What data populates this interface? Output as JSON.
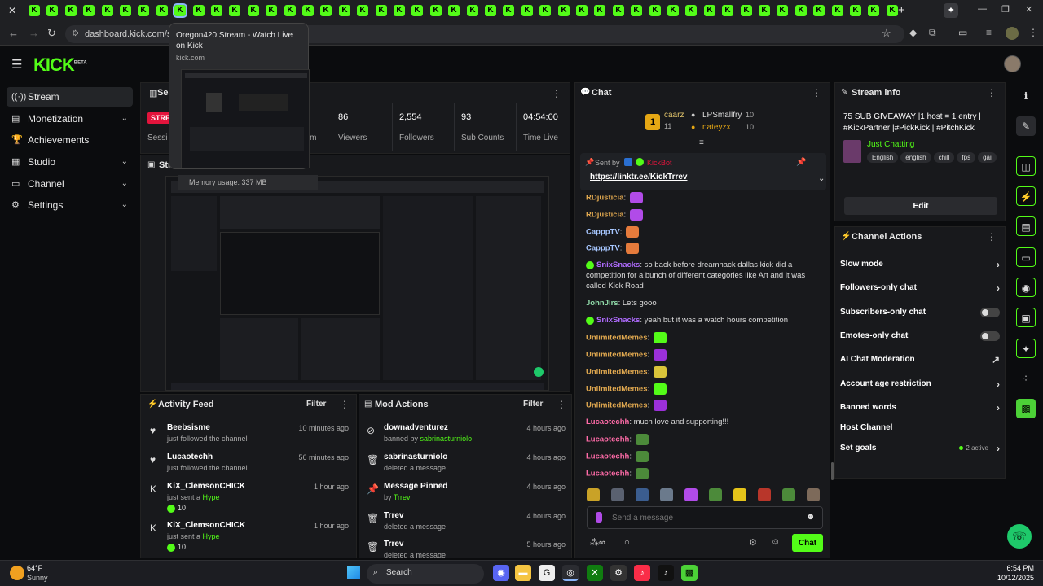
{
  "browser": {
    "tab_glyph": "K",
    "new_tab": "+",
    "url": "dashboard.kick.com/strea",
    "tooltip": {
      "title": "Oregon420 Stream - Watch Live on Kick",
      "host": "kick.com",
      "memory": "Memory usage: 337 MB"
    }
  },
  "header": {
    "logo": "KICK",
    "logo_badge": "BETA"
  },
  "sidebar": {
    "items": [
      {
        "label": "Stream",
        "icon": "((·))"
      },
      {
        "label": "Monetization",
        "icon": "▤"
      },
      {
        "label": "Achievements",
        "icon": "🏆"
      },
      {
        "label": "Studio",
        "icon": "▦"
      },
      {
        "label": "Channel",
        "icon": "▭"
      },
      {
        "label": "Settings",
        "icon": "⚙"
      }
    ]
  },
  "session": {
    "title": "Session",
    "live_badge": "STRE",
    "session_label": "Sessi",
    "stream_label": "eam",
    "stats": [
      {
        "value": "86",
        "label": "Viewers"
      },
      {
        "value": "2,554",
        "label": "Followers"
      },
      {
        "value": "93",
        "label": "Sub Counts"
      },
      {
        "value": "04:54:00",
        "label": "Time Live"
      }
    ]
  },
  "preview": {
    "title": "Str"
  },
  "activity_feed": {
    "title": "Activity Feed",
    "filter": "Filter",
    "items": [
      {
        "name": "Beebsisme",
        "sub": "just followed the channel",
        "time": "10 minutes ago",
        "icon": "♥"
      },
      {
        "name": "Lucaotechh",
        "sub": "just followed the channel",
        "time": "56 minutes ago",
        "icon": "♥"
      },
      {
        "name": "KiX_ClemsonCHICK",
        "sub_pre": "just sent a ",
        "sub_hl": "Hype",
        "amount": "10",
        "time": "1 hour ago",
        "icon": "K"
      },
      {
        "name": "KiX_ClemsonCHICK",
        "sub_pre": "just sent a ",
        "sub_hl": "Hype",
        "amount": "10",
        "time": "1 hour ago",
        "icon": "K"
      }
    ]
  },
  "mod_actions": {
    "title": "Mod Actions",
    "filter": "Filter",
    "items": [
      {
        "name": "downadventurez",
        "sub_pre": "banned by ",
        "sub_hl": "sabrinasturniolo",
        "time": "4 hours ago",
        "icon": "⊘"
      },
      {
        "name": "sabrinasturniolo",
        "sub_pre": "deleted a message",
        "sub_hl": "",
        "time": "4 hours ago",
        "icon": "🗑"
      },
      {
        "name": "Message Pinned",
        "sub_pre": "by ",
        "sub_hl": "Trrev",
        "time": "4 hours ago",
        "icon": "📌"
      },
      {
        "name": "Trrev",
        "sub_pre": "deleted a message",
        "sub_hl": "",
        "time": "4 hours ago",
        "icon": "🗑"
      },
      {
        "name": "Trrev",
        "sub_pre": "deleted a message",
        "sub_hl": "",
        "time": "5 hours ago",
        "icon": "🗑"
      }
    ]
  },
  "chat": {
    "title": "Chat",
    "top_users": [
      {
        "name": "caarz",
        "count": "11"
      },
      {
        "name": "LPSmallfry",
        "count": "10"
      },
      {
        "name": "nateyzx",
        "count": "10"
      }
    ],
    "pinned": {
      "sent_by_label": "Sent by",
      "sender": "KickBot",
      "link": "https://linktr.ee/KickTrrev"
    },
    "messages": [
      {
        "user": "RDjusticia",
        "color": "#e0a84f",
        "text": "",
        "emote": "#b14be8"
      },
      {
        "user": "RDjusticia",
        "color": "#e0a84f",
        "text": "",
        "emote": "#b14be8"
      },
      {
        "user": "CapppTV",
        "color": "#a7c7ff",
        "text": "",
        "emote": "#e57b3c"
      },
      {
        "user": "CapppTV",
        "color": "#a7c7ff",
        "text": "",
        "emote": "#e57b3c"
      },
      {
        "user": "SnixSnacks",
        "color": "#b06cff",
        "text": "so back before dreamhack dallas kick did a competition for a bunch of different categories like Art and it was called Kick Road",
        "emote": ""
      },
      {
        "user": "JohnJirs",
        "color": "#8fd9a8",
        "text": "Lets gooo",
        "emote": ""
      },
      {
        "user": "SnixSnacks",
        "color": "#b06cff",
        "text": "yeah but it was a watch hours competition",
        "emote": ""
      },
      {
        "user": "UnlimitedMemes",
        "color": "#e0a84f",
        "text": "",
        "emote": "#53fc18"
      },
      {
        "user": "UnlimitedMemes",
        "color": "#e0a84f",
        "text": "",
        "emote": "#9b30d9"
      },
      {
        "user": "UnlimitedMemes",
        "color": "#e0a84f",
        "text": "",
        "emote": "#d9c43a"
      },
      {
        "user": "UnlimitedMemes",
        "color": "#e0a84f",
        "text": "",
        "emote": "#53fc18"
      },
      {
        "user": "UnlimitedMemes",
        "color": "#e0a84f",
        "text": "",
        "emote": "#9b30d9"
      },
      {
        "user": "Lucaotechh",
        "color": "#ff6ba8",
        "text": "much love and supporting!!!",
        "emote": ""
      },
      {
        "user": "Lucaotechh",
        "color": "#ff6ba8",
        "text": "",
        "emote": "#4c8a3a"
      },
      {
        "user": "Lucaotechh",
        "color": "#ff6ba8",
        "text": "",
        "emote": "#4c8a3a"
      },
      {
        "user": "Lucaotechh",
        "color": "#ff6ba8",
        "text": "",
        "emote": "#4c8a3a"
      }
    ],
    "input_placeholder": "Send a message",
    "send_label": "Chat"
  },
  "stream_info": {
    "title": "Stream info",
    "stream_title": "75 SUB GIVEAWAY |1 host = 1 entry | #KickPartner |#PickKick | #PitchKick",
    "category": "Just Chatting",
    "tags": [
      "English",
      "english",
      "chill",
      "fps",
      "gai"
    ],
    "edit_label": "Edit"
  },
  "channel_actions": {
    "title": "Channel Actions",
    "rows": [
      {
        "label": "Slow mode",
        "control": "arrow"
      },
      {
        "label": "Followers-only chat",
        "control": "arrow"
      },
      {
        "label": "Subscribers-only chat",
        "control": "toggle"
      },
      {
        "label": "Emotes-only chat",
        "control": "toggle"
      },
      {
        "label": "AI Chat Moderation",
        "control": "external"
      },
      {
        "label": "Account age restriction",
        "control": "arrow"
      },
      {
        "label": "Banned words",
        "control": "arrow"
      },
      {
        "label": "Host Channel",
        "control": "none"
      },
      {
        "label": "Set goals",
        "control": "arrow"
      }
    ],
    "goals_active": "2 active"
  },
  "taskbar": {
    "weather_temp": "64°F",
    "weather_desc": "Sunny",
    "search_label": "Search",
    "time": "6:54 PM",
    "date": "10/12/2025"
  },
  "colors": {
    "brand": "#53fc18",
    "panel": "#18191c",
    "bg": "#0b0c0e"
  }
}
